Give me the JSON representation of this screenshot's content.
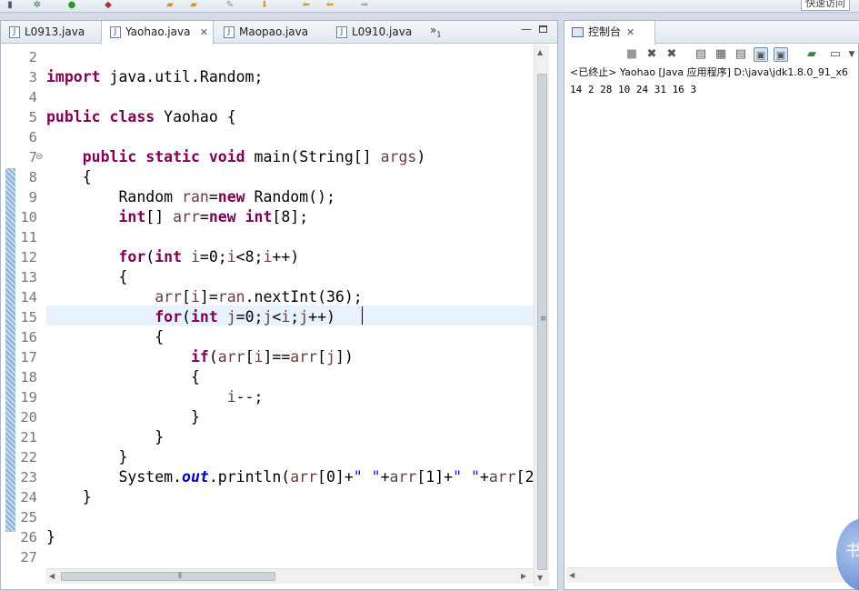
{
  "toolbar": {
    "quick_access": "快速访问"
  },
  "editor": {
    "tabs": [
      {
        "label": "L0913.java",
        "active": false
      },
      {
        "label": "Yaohao.java",
        "active": true
      },
      {
        "label": "Maopao.java",
        "active": false
      },
      {
        "label": "L0910.java",
        "active": false
      }
    ],
    "overflow": {
      "glyph": "»",
      "count": "1"
    },
    "line_numbers": [
      "2",
      "3",
      "4",
      "5",
      "6",
      "7",
      "8",
      "9",
      "10",
      "11",
      "12",
      "13",
      "14",
      "15",
      "16",
      "17",
      "18",
      "19",
      "20",
      "21",
      "22",
      "23",
      "24",
      "25",
      "26",
      "27"
    ],
    "current_line": "14",
    "code_lines": [
      [],
      [
        {
          "t": "import",
          "c": "kw"
        },
        {
          "t": " java.util.Random;"
        }
      ],
      [],
      [
        {
          "t": "public",
          "c": "kw"
        },
        {
          "t": " "
        },
        {
          "t": "class",
          "c": "kw"
        },
        {
          "t": " Yaohao {"
        }
      ],
      [],
      [
        {
          "t": "    "
        },
        {
          "t": "public",
          "c": "kw"
        },
        {
          "t": " "
        },
        {
          "t": "static",
          "c": "kw"
        },
        {
          "t": " "
        },
        {
          "t": "void",
          "c": "kw"
        },
        {
          "t": " main(String[] "
        },
        {
          "t": "args",
          "c": "var"
        },
        {
          "t": ")"
        }
      ],
      [
        {
          "t": "    {"
        }
      ],
      [
        {
          "t": "        Random "
        },
        {
          "t": "ran",
          "c": "var"
        },
        {
          "t": "="
        },
        {
          "t": "new",
          "c": "kw"
        },
        {
          "t": " Random();"
        }
      ],
      [
        {
          "t": "        "
        },
        {
          "t": "int",
          "c": "kw"
        },
        {
          "t": "[] "
        },
        {
          "t": "arr",
          "c": "var"
        },
        {
          "t": "="
        },
        {
          "t": "new",
          "c": "kw"
        },
        {
          "t": " "
        },
        {
          "t": "int",
          "c": "kw"
        },
        {
          "t": "[8];"
        }
      ],
      [],
      [
        {
          "t": "        "
        },
        {
          "t": "for",
          "c": "kw"
        },
        {
          "t": "("
        },
        {
          "t": "int",
          "c": "kw"
        },
        {
          "t": " "
        },
        {
          "t": "i",
          "c": "var"
        },
        {
          "t": "=0;"
        },
        {
          "t": "i",
          "c": "var"
        },
        {
          "t": "<8;"
        },
        {
          "t": "i",
          "c": "var"
        },
        {
          "t": "++)"
        }
      ],
      [
        {
          "t": "        {"
        }
      ],
      [
        {
          "t": "            "
        },
        {
          "t": "arr",
          "c": "var"
        },
        {
          "t": "["
        },
        {
          "t": "i",
          "c": "var"
        },
        {
          "t": "]="
        },
        {
          "t": "ran",
          "c": "var"
        },
        {
          "t": ".nextInt(36);"
        }
      ],
      [
        {
          "t": "            "
        },
        {
          "t": "for",
          "c": "kw"
        },
        {
          "t": "("
        },
        {
          "t": "int",
          "c": "kw"
        },
        {
          "t": " "
        },
        {
          "t": "j",
          "c": "var"
        },
        {
          "t": "=0;"
        },
        {
          "t": "j",
          "c": "var"
        },
        {
          "t": "<"
        },
        {
          "t": "i",
          "c": "var"
        },
        {
          "t": ";"
        },
        {
          "t": "j",
          "c": "var"
        },
        {
          "t": "++)"
        }
      ],
      [
        {
          "t": "            {"
        }
      ],
      [
        {
          "t": "                "
        },
        {
          "t": "if",
          "c": "kw"
        },
        {
          "t": "("
        },
        {
          "t": "arr",
          "c": "var"
        },
        {
          "t": "["
        },
        {
          "t": "i",
          "c": "var"
        },
        {
          "t": "]=="
        },
        {
          "t": "arr",
          "c": "var"
        },
        {
          "t": "["
        },
        {
          "t": "j",
          "c": "var"
        },
        {
          "t": "])"
        }
      ],
      [
        {
          "t": "                {"
        }
      ],
      [
        {
          "t": "                    "
        },
        {
          "t": "i",
          "c": "var"
        },
        {
          "t": "--;"
        }
      ],
      [
        {
          "t": "                }"
        }
      ],
      [
        {
          "t": "            }"
        }
      ],
      [
        {
          "t": "        }"
        }
      ],
      [
        {
          "t": "        System."
        },
        {
          "t": "out",
          "c": "fld"
        },
        {
          "t": ".println("
        },
        {
          "t": "arr",
          "c": "var"
        },
        {
          "t": "[0]+"
        },
        {
          "t": "\" \"",
          "c": "str"
        },
        {
          "t": "+"
        },
        {
          "t": "arr",
          "c": "var"
        },
        {
          "t": "[1]+"
        },
        {
          "t": "\" \"",
          "c": "str"
        },
        {
          "t": "+"
        },
        {
          "t": "arr",
          "c": "var"
        },
        {
          "t": "[2"
        }
      ],
      [
        {
          "t": "    }"
        }
      ],
      [],
      [
        {
          "t": "}"
        }
      ],
      []
    ]
  },
  "console": {
    "tab_label": "控制台",
    "status": "<已终止> Yaohao [Java 应用程序] D:\\java\\jdk1.8.0_91_x6",
    "output": "14 2 28 10 24 31 16 3"
  },
  "colors": {
    "keyword": "#7f0055",
    "variable": "#6a3e3e",
    "string": "#2a00ff",
    "field": "#0000c0",
    "current_line_bg": "#e8f2fe"
  }
}
